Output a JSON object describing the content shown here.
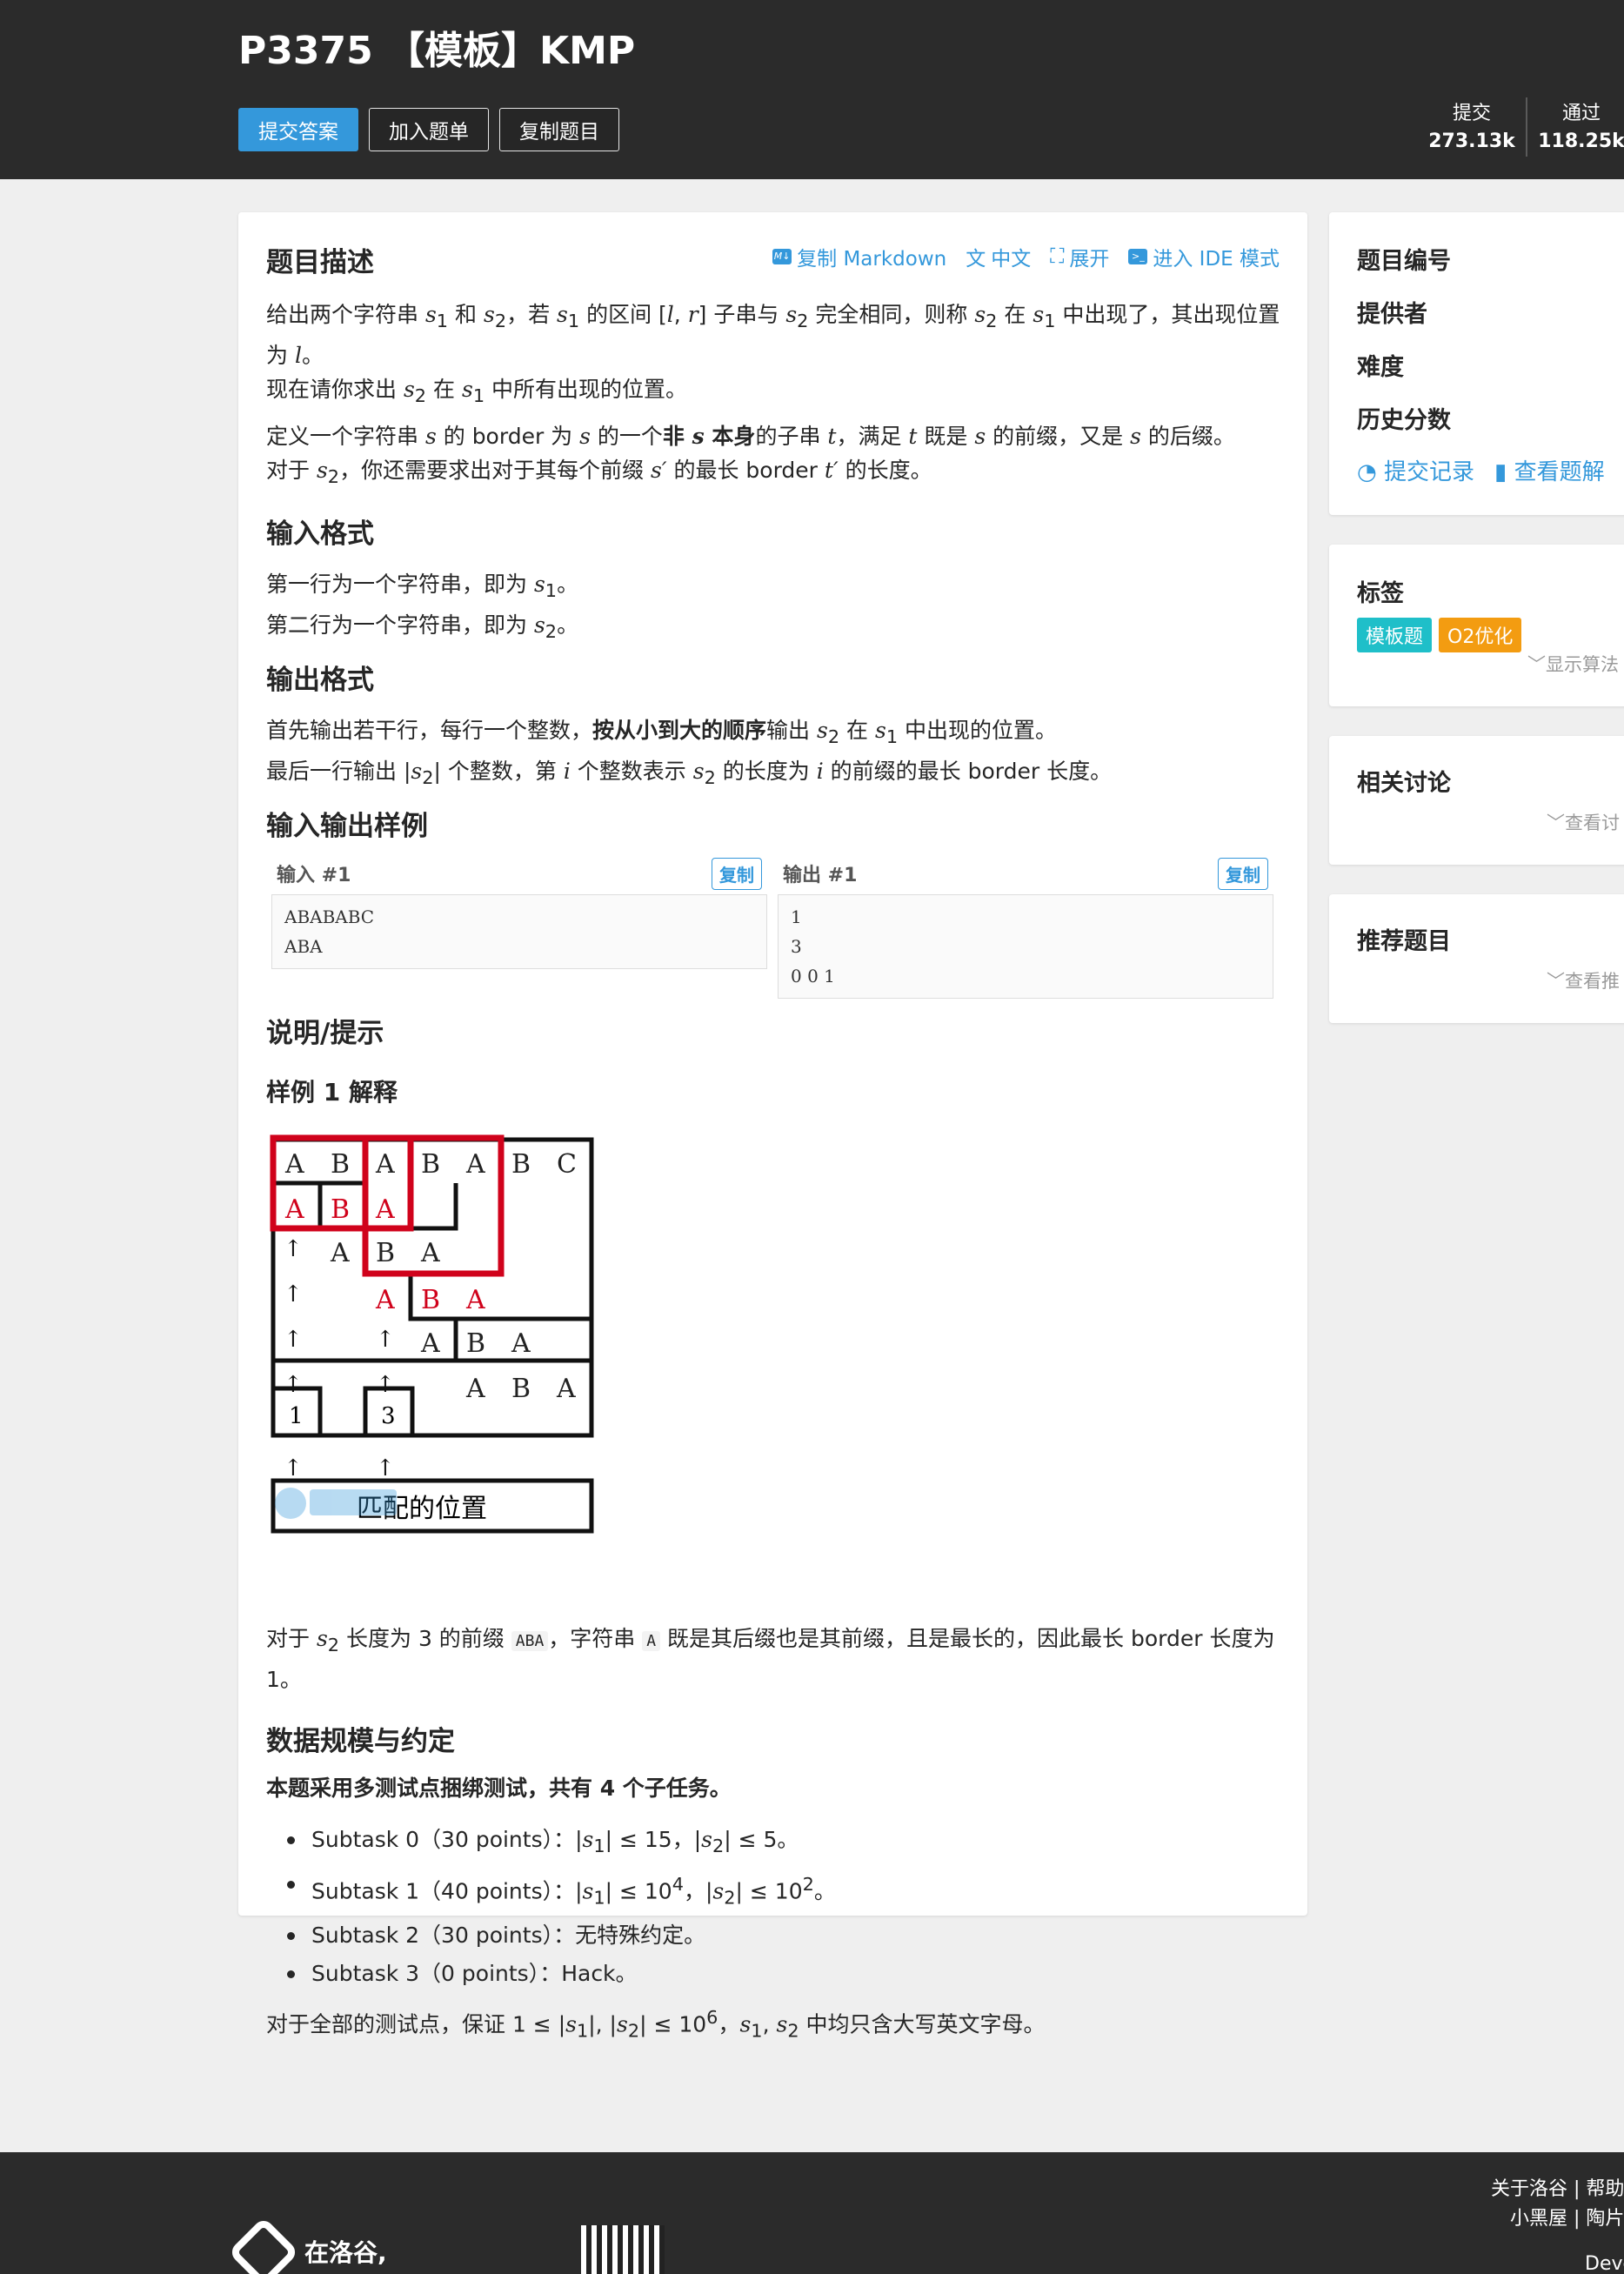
{
  "header": {
    "title": "P3375 【模板】KMP",
    "buttons": [
      "提交答案",
      "加入题单",
      "复制题目"
    ],
    "stats": [
      {
        "label": "提交",
        "value": "273.13k"
      },
      {
        "label": "通过",
        "value": "118.25k"
      }
    ]
  },
  "toolbar": {
    "copy_md": "复制 Markdown",
    "lang": "中文",
    "expand": "展开",
    "ide": "进入 IDE 模式"
  },
  "main": {
    "desc_title": "题目描述",
    "input_title": "输入格式",
    "output_title": "输出格式",
    "sample_title": "输入输出样例",
    "hint_title": "说明/提示",
    "sample_expl_title": "样例 1 解释",
    "data_title": "数据规模与约定",
    "data_intro": "本题采用多测试点捆绑测试，共有 4 个子任务。"
  },
  "samples": {
    "input_label": "输入 #1",
    "output_label": "输出 #1",
    "copy": "复制",
    "input": [
      "ABABABC",
      "ABA"
    ],
    "output": [
      "1",
      "3",
      "0 0 1"
    ]
  },
  "figure": {
    "row1": [
      "A",
      "B",
      "A",
      "B",
      "A",
      "B",
      "C"
    ],
    "caption": "匹配的位置",
    "marks": [
      "1",
      "3"
    ]
  },
  "sidebar": {
    "info": [
      "题目编号",
      "提供者",
      "难度",
      "历史分数"
    ],
    "links": [
      "提交记录",
      "查看题解"
    ],
    "tags_title": "标签",
    "tags": [
      "模板题",
      "O2优化"
    ],
    "show_algo": "显示算法",
    "discuss_title": "相关讨论",
    "discuss_more": "查看讨",
    "rec_title": "推荐题目",
    "rec_more": "查看推"
  },
  "footer": {
    "links1": "关于洛谷 | 帮助",
    "links2": "小黑屋 | 陶片",
    "slogan": "在洛谷,",
    "dev": "Develop"
  },
  "colors": {
    "accent": "#3498db",
    "tag1": "#1fbfc9",
    "tag2": "#f39c11"
  }
}
